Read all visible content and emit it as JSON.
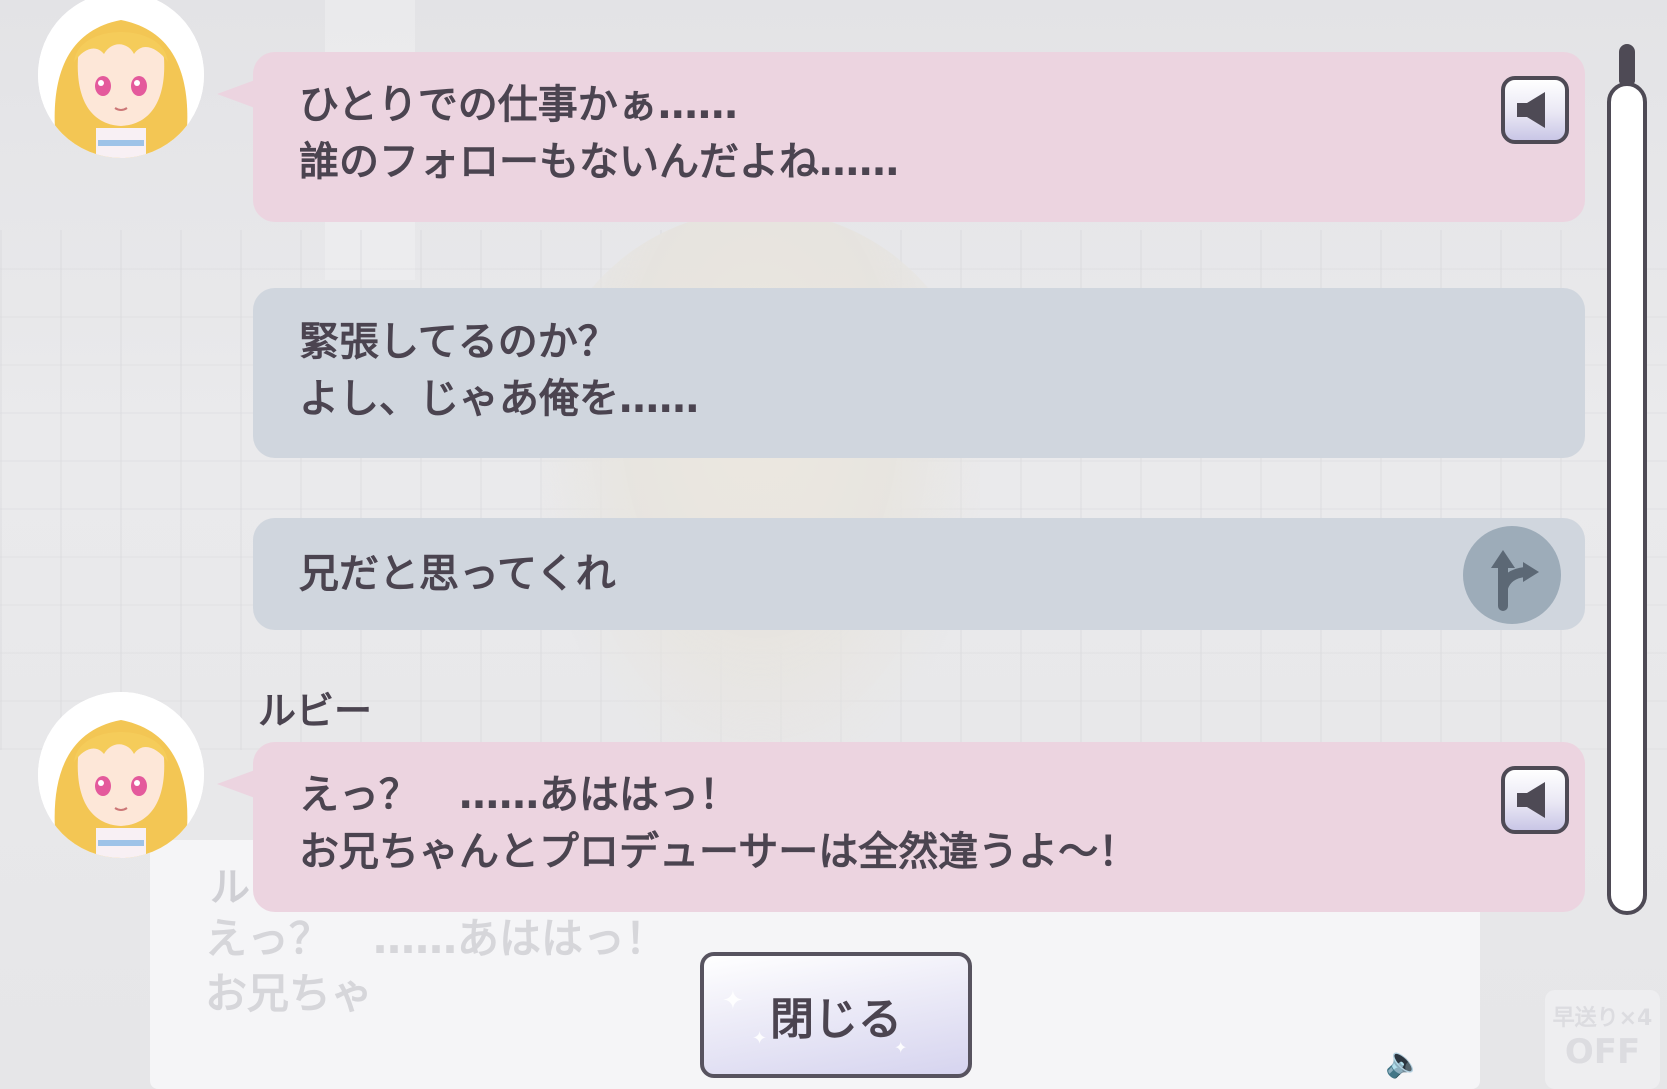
{
  "background": {
    "dialog_name": "ル",
    "dialog_lines": [
      "えっ？　……あははっ！",
      "お兄ちゃ"
    ],
    "fast_forward": {
      "label": "早送り×4",
      "state": "OFF"
    }
  },
  "log": {
    "entries": [
      {
        "type": "npc",
        "speaker": "",
        "lines": [
          "ひとりでの仕事かぁ……",
          "誰のフォローもないんだよね……"
        ],
        "voice_icon": "speaker-icon"
      },
      {
        "type": "player",
        "lines": [
          "緊張してるのか？",
          "よし、じゃあ俺を……"
        ]
      },
      {
        "type": "choice",
        "lines": [
          "兄だと思ってくれ"
        ],
        "badge_icon": "branch-arrow-icon"
      },
      {
        "type": "npc",
        "speaker": "ルビー",
        "lines": [
          "えっ？　……あははっ！",
          "お兄ちゃんとプロデューサーは全然違うよ～！"
        ],
        "voice_icon": "speaker-icon"
      }
    ]
  },
  "close_button": {
    "label": "閉じる"
  },
  "colors": {
    "npc_bubble": "#ecd4e0",
    "player_bubble": "#d0d6de",
    "text": "#4b4450",
    "outline": "#4e4a55"
  }
}
